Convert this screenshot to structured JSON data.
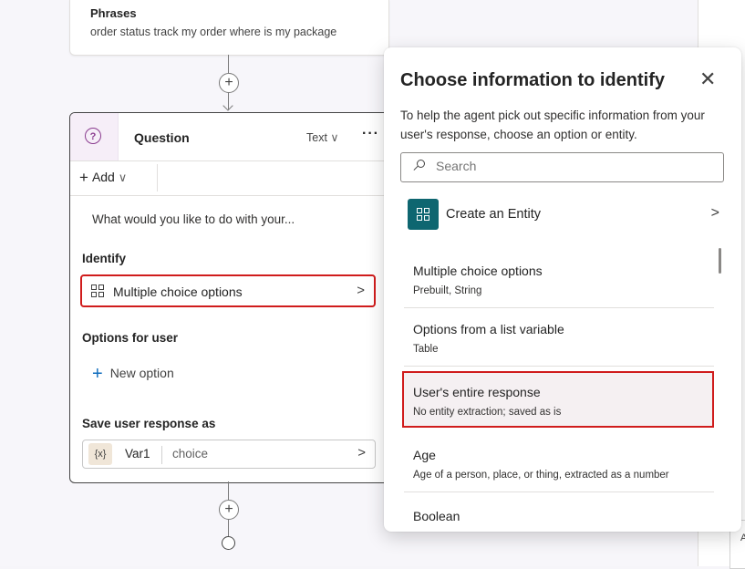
{
  "trigger": {
    "title": "Phrases",
    "phrases": "order status track my order where is my package"
  },
  "question_node": {
    "title": "Question",
    "type_label": "Text",
    "type_chevron": "∨",
    "more": "···",
    "add_label": "Add",
    "add_chevron": "∨",
    "prompt_text": "What would you like to do with your...",
    "identify_label": "Identify",
    "identify_value": "Multiple choice options",
    "options_label": "Options for user",
    "new_option_label": "New option",
    "save_label": "Save user response as",
    "var_chip": "{x}",
    "var_name": "Var1",
    "var_type": "choice",
    "chevron": ">"
  },
  "flyout": {
    "title": "Choose information to identify",
    "close": "✕",
    "description": "To help the agent pick out specific information from your user's response, choose an option or entity.",
    "search_placeholder": "Search",
    "create_label": "Create an Entity",
    "create_chevron": ">",
    "items": [
      {
        "name": "Multiple choice options",
        "desc": "Prebuilt, String"
      },
      {
        "name": "Options from a list variable",
        "desc": "Table"
      },
      {
        "name": "User's entire response",
        "desc": "No entity extraction; saved as is"
      },
      {
        "name": "Age",
        "desc": "Age of a person, place, or thing, extracted as a number"
      },
      {
        "name": "Boolean",
        "desc": ""
      }
    ]
  },
  "colors": {
    "accent": "#0f6cbd",
    "highlight_border": "#d01c1c",
    "entity_teal": "#0e6670",
    "question_icon": "#8a3b8f"
  },
  "edge_text": "A"
}
